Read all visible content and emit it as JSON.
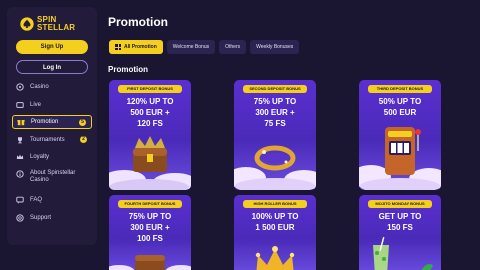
{
  "brand": {
    "line1": "SPIN",
    "line2": "STELLAR",
    "accent": "#f5cf1e",
    "bg": "#1a1530"
  },
  "auth": {
    "signup_label": "Sign Up",
    "login_label": "Log In"
  },
  "sidebar": {
    "items": [
      {
        "label": "Casino",
        "icon": "casino-icon"
      },
      {
        "label": "Live",
        "icon": "live-icon"
      },
      {
        "label": "Promotion",
        "icon": "gift-icon",
        "badge": "5",
        "active": true
      },
      {
        "label": "Tournaments",
        "icon": "trophy-icon",
        "badge": "2"
      },
      {
        "label": "Loyalty",
        "icon": "crown-icon"
      },
      {
        "label": "About Spinstellar Casino",
        "icon": "info-icon"
      },
      {
        "label": "FAQ",
        "icon": "faq-icon"
      },
      {
        "label": "Support",
        "icon": "support-icon"
      }
    ]
  },
  "main": {
    "title": "Promotion",
    "tabs": [
      {
        "label": "All Promotion",
        "active": true
      },
      {
        "label": "Welcome Bonus"
      },
      {
        "label": "Others"
      },
      {
        "label": "Weekly Bonuses"
      }
    ],
    "section_title": "Promotion",
    "cards": [
      {
        "tag": "FIRST DEPOSIT BONUS",
        "line1": "120% UP TO",
        "line2": "500 EUR +",
        "line3": "120 FS"
      },
      {
        "tag": "SECOND DEPOSIT BONUS",
        "line1": "75% UP TO",
        "line2": "300 EUR +",
        "line3": "75 FS"
      },
      {
        "tag": "THIRD DEPOSIT BONUS",
        "line1": "50% UP TO",
        "line2": "500 EUR",
        "line3": ""
      },
      {
        "tag": "FOURTH DEPOSIT BONUS",
        "line1": "75% UP TO",
        "line2": "300 EUR +",
        "line3": "100 FS"
      },
      {
        "tag": "HIGH ROLLER BONUS",
        "line1": "100% UP TO",
        "line2": "1 500 EUR",
        "line3": ""
      },
      {
        "tag": "MOJITO MONDAY BONUS",
        "line1": "GET UP TO",
        "line2": "150 FS",
        "line3": ""
      }
    ]
  }
}
